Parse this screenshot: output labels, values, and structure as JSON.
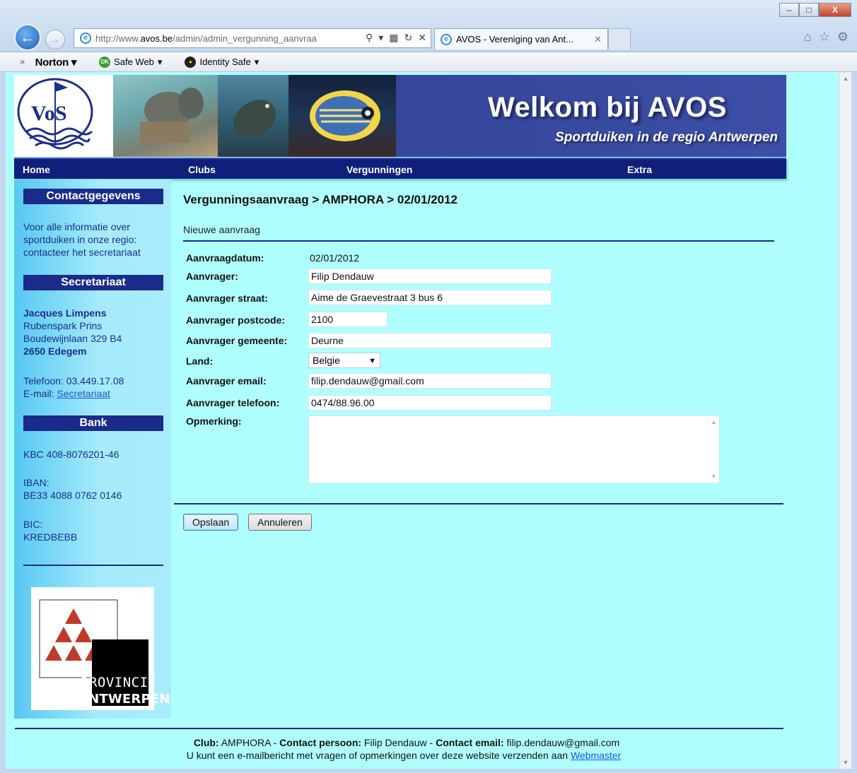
{
  "browser": {
    "url_prefix": "http://www.",
    "url_domain": "avos.be",
    "url_path": "/admin/admin_vergunning_aanvraa",
    "tab_title": "AVOS - Vereniging van Ant...",
    "minimize": "–",
    "maximize": "□",
    "close": "X"
  },
  "norton": {
    "close": "×",
    "brand": "Norton",
    "safe_web": "Safe Web",
    "safe_web_badge": "OK",
    "identity_safe": "Identity Safe"
  },
  "banner": {
    "title": "Welkom bij AVOS",
    "subtitle": "Sportduiken in de regio Antwerpen",
    "logo_text": "VoS"
  },
  "menu": [
    "Home",
    "Clubs",
    "Vergunningen",
    "Extra"
  ],
  "sidebar": {
    "contact_heading": "Contactgegevens",
    "contact_text": "Voor alle informatie over sportduiken in onze regio: contacteer het secretariaat",
    "secretariaat_heading": "Secretariaat",
    "name": "Jacques Limpens",
    "address1": "Rubenspark Prins",
    "address2": "Boudewijnlaan 329 B4",
    "address3": "2650 Edegem",
    "phone": "Telefoon: 03.449.17.08",
    "email_prefix": "E-mail: ",
    "email_link": "Secretariaat",
    "bank_heading": "Bank",
    "kbc": "KBC 408-8076201-46",
    "iban_label": "IBAN:",
    "iban": "BE33 4088 0762 0146",
    "bic_label": "BIC:",
    "bic": "KREDBEBB",
    "prov_text1": "PROVINCIE",
    "prov_text2": "ANTWERPEN"
  },
  "content": {
    "title": "Vergunningsaanvraag > AMPHORA > 02/01/2012",
    "subtitle": "Nieuwe aanvraag",
    "fields": {
      "datum_label": "Aanvraagdatum:",
      "datum_value": "02/01/2012",
      "aanvrager_label": "Aanvrager:",
      "aanvrager_value": "Filip Dendauw",
      "straat_label": "Aanvrager straat:",
      "straat_value": "Aime de Graevestraat 3 bus 6",
      "postcode_label": "Aanvrager postcode:",
      "postcode_value": "2100",
      "gemeente_label": "Aanvrager gemeente:",
      "gemeente_value": "Deurne",
      "land_label": "Land:",
      "land_value": "Belgie",
      "email_label": "Aanvrager email:",
      "email_value": "filip.dendauw@gmail.com",
      "telefoon_label": "Aanvrager telefoon:",
      "telefoon_value": "0474/88.96.00",
      "opmerking_label": "Opmerking:",
      "opmerking_value": ""
    },
    "save_button": "Opslaan",
    "cancel_button": "Annuleren"
  },
  "footer": {
    "club_label": "Club:",
    "club_value": " AMPHORA - ",
    "contact_label": "Contact persoon:",
    "contact_value": " Filip Dendauw - ",
    "email_label": "Contact email:",
    "email_value": " filip.dendauw@gmail.com",
    "line2_text": "U kunt een e-mailbericht met vragen of opmerkingen over deze website verzenden aan ",
    "line2_link": "Webmaster"
  },
  "colors": {
    "page_bg": "#b0ffff",
    "nav_bg": "#0f1f7a",
    "heading_bg": "#1a2b8a"
  }
}
